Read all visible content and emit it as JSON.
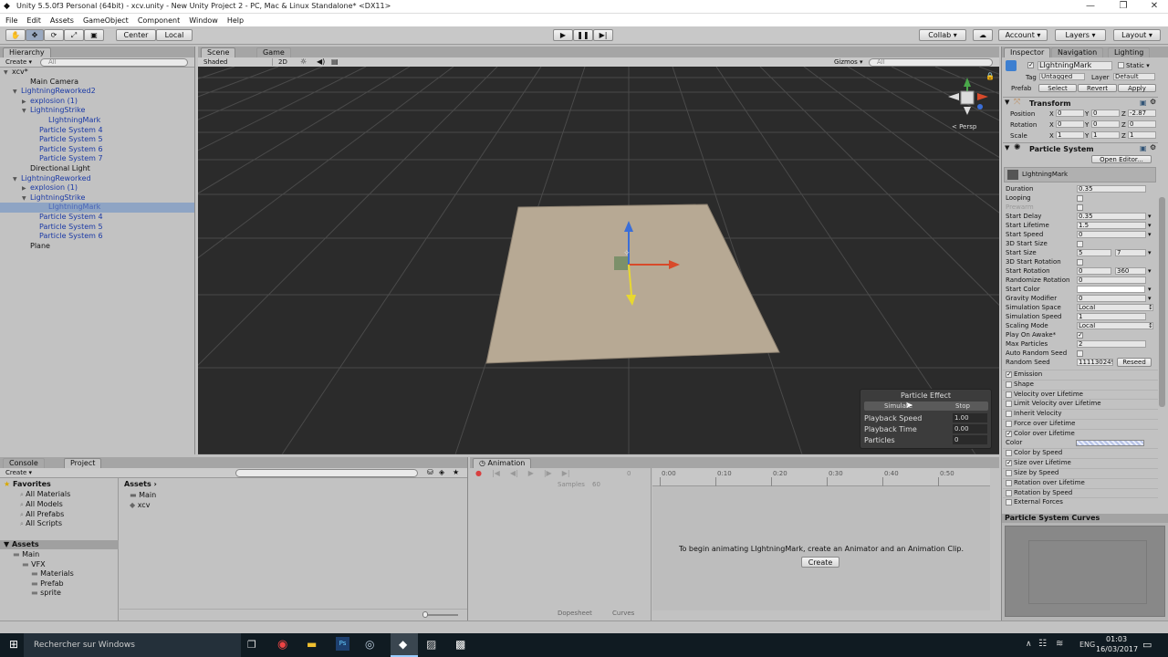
{
  "window": {
    "title": "Unity 5.5.0f3 Personal (64bit) - xcv.unity - New Unity Project 2 - PC, Mac & Linux Standalone* <DX11>",
    "controls": [
      "—",
      "❐",
      "✕"
    ]
  },
  "menu": [
    "File",
    "Edit",
    "Assets",
    "GameObject",
    "Component",
    "Window",
    "Help"
  ],
  "toolbar": {
    "center": "Center",
    "local": "Local",
    "collab": "Collab ▾",
    "account": "Account ▾",
    "layers": "Layers ▾",
    "layout": "Layout ▾",
    "icons": {
      "hand": "hand-icon",
      "move": "move-icon",
      "rotate": "rotate-icon",
      "scale": "scale-icon",
      "rect": "rect-icon",
      "play": "play-icon",
      "pause": "pause-icon",
      "step": "step-icon",
      "cloud": "cloud-icon"
    }
  },
  "hierarchy": {
    "tab": "Hierarchy",
    "create": "Create ▾",
    "search": "All",
    "items": [
      {
        "label": "xcv*",
        "indent": 0,
        "arrow": "▼",
        "blue": false,
        "sel": false
      },
      {
        "label": "Main Camera",
        "indent": 2,
        "arrow": "",
        "blue": false,
        "sel": false
      },
      {
        "label": "LightningReworked2",
        "indent": 1,
        "arrow": "▼",
        "blue": true,
        "sel": false
      },
      {
        "label": "explosion (1)",
        "indent": 2,
        "arrow": "▶",
        "blue": true,
        "sel": false
      },
      {
        "label": "LightningStrike",
        "indent": 2,
        "arrow": "▼",
        "blue": true,
        "sel": false
      },
      {
        "label": "LIghtningMark",
        "indent": 4,
        "arrow": "",
        "blue": true,
        "sel": false
      },
      {
        "label": "Particle System 4",
        "indent": 3,
        "arrow": "",
        "blue": true,
        "sel": false
      },
      {
        "label": "Particle System 5",
        "indent": 3,
        "arrow": "",
        "blue": true,
        "sel": false
      },
      {
        "label": "Particle System 6",
        "indent": 3,
        "arrow": "",
        "blue": true,
        "sel": false
      },
      {
        "label": "Particle System 7",
        "indent": 3,
        "arrow": "",
        "blue": true,
        "sel": false
      },
      {
        "label": "Directional Light",
        "indent": 2,
        "arrow": "",
        "blue": false,
        "sel": false
      },
      {
        "label": "LightningReworked",
        "indent": 1,
        "arrow": "▼",
        "blue": true,
        "sel": false
      },
      {
        "label": "explosion (1)",
        "indent": 2,
        "arrow": "▶",
        "blue": true,
        "sel": false
      },
      {
        "label": "LightningStrike",
        "indent": 2,
        "arrow": "▼",
        "blue": true,
        "sel": false
      },
      {
        "label": "LIghtningMark",
        "indent": 4,
        "arrow": "",
        "blue": true,
        "sel": true
      },
      {
        "label": "Particle System 4",
        "indent": 3,
        "arrow": "",
        "blue": true,
        "sel": false
      },
      {
        "label": "Particle System 5",
        "indent": 3,
        "arrow": "",
        "blue": true,
        "sel": false
      },
      {
        "label": "Particle System 6",
        "indent": 3,
        "arrow": "",
        "blue": true,
        "sel": false
      },
      {
        "label": "Plane",
        "indent": 2,
        "arrow": "",
        "blue": false,
        "sel": false
      }
    ]
  },
  "scene": {
    "tabs": [
      "Scene",
      "Game"
    ],
    "shaded": "Shaded",
    "mode2d": "2D",
    "fx": "☼",
    "gizmos": "Gizmos ▾",
    "search": "All",
    "persp": "< Persp",
    "particle_effect": {
      "title": "Particle Effect",
      "simulate": "Simulate",
      "stop": "Stop",
      "rows": [
        {
          "label": "Playback Speed",
          "value": "1.00"
        },
        {
          "label": "Playback Time",
          "value": "0.00"
        },
        {
          "label": "Particles",
          "value": "0"
        }
      ]
    }
  },
  "inspector": {
    "tabs": [
      "Inspector",
      "Navigation",
      "Lighting"
    ],
    "object_name": "LIghtningMark",
    "static": "Static ▾",
    "tag_label": "Tag",
    "tag": "Untagged",
    "layer_label": "Layer",
    "layer": "Default",
    "prefab_label": "Prefab",
    "prefab_buttons": [
      "Select",
      "Revert",
      "Apply"
    ],
    "transform": {
      "title": "Transform",
      "rows": [
        {
          "label": "Position",
          "x": "0",
          "y": "0",
          "z": "-2.87"
        },
        {
          "label": "Rotation",
          "x": "0",
          "y": "0",
          "z": "0"
        },
        {
          "label": "Scale",
          "x": "1",
          "y": "1",
          "z": "1"
        }
      ]
    },
    "ps_title": "Particle System",
    "open_editor": "Open Editor...",
    "ps_name": "LIghtningMark",
    "props": [
      {
        "label": "Duration",
        "type": "text",
        "value": "0.35"
      },
      {
        "label": "Looping",
        "type": "check",
        "value": ""
      },
      {
        "label": "Prewarm",
        "type": "check",
        "value": "",
        "dim": true
      },
      {
        "label": "Start Delay",
        "type": "text",
        "value": "0.35",
        "menu": true
      },
      {
        "label": "Start Lifetime",
        "type": "text",
        "value": "1.5",
        "menu": true
      },
      {
        "label": "Start Speed",
        "type": "text",
        "value": "0",
        "menu": true
      },
      {
        "label": "3D Start Size",
        "type": "check",
        "value": ""
      },
      {
        "label": "Start Size",
        "type": "range",
        "value": "5",
        "value2": "7",
        "menu": true
      },
      {
        "label": "3D Start Rotation",
        "type": "check",
        "value": ""
      },
      {
        "label": "Start Rotation",
        "type": "range",
        "value": "0",
        "value2": "360",
        "menu": true
      },
      {
        "label": "Randomize Rotation",
        "type": "text",
        "value": "0"
      },
      {
        "label": "Start Color",
        "type": "color",
        "value": "",
        "menu": true
      },
      {
        "label": "Gravity Modifier",
        "type": "text",
        "value": "0",
        "menu": true
      },
      {
        "label": "Simulation Space",
        "type": "select",
        "value": "Local"
      },
      {
        "label": "Simulation Speed",
        "type": "text",
        "value": "1"
      },
      {
        "label": "Scaling Mode",
        "type": "select",
        "value": "Local"
      },
      {
        "label": "Play On Awake*",
        "type": "check",
        "value": "✓"
      },
      {
        "label": "Max Particles",
        "type": "text",
        "value": "2"
      },
      {
        "label": "Auto Random Seed",
        "type": "check",
        "value": ""
      },
      {
        "label": "Random Seed",
        "type": "seed",
        "value": "111130249",
        "button": "Reseed"
      }
    ],
    "modules": [
      {
        "label": "Emission",
        "checked": true
      },
      {
        "label": "Shape",
        "checked": false
      },
      {
        "label": "Velocity over Lifetime",
        "checked": false
      },
      {
        "label": "Limit Velocity over Lifetime",
        "checked": false
      },
      {
        "label": "Inherit Velocity",
        "checked": false
      },
      {
        "label": "Force over Lifetime",
        "checked": false
      },
      {
        "label": "Color over Lifetime",
        "checked": true
      },
      {
        "label": "Color",
        "checked": false,
        "sub": true
      },
      {
        "label": "Color by Speed",
        "checked": false
      },
      {
        "label": "Size over Lifetime",
        "checked": true
      },
      {
        "label": "Size by Speed",
        "checked": false
      },
      {
        "label": "Rotation over Lifetime",
        "checked": false
      },
      {
        "label": "Rotation by Speed",
        "checked": false
      },
      {
        "label": "External Forces",
        "checked": false
      }
    ],
    "curves_title": "Particle System Curves"
  },
  "project": {
    "tabs": [
      "Console",
      "Project"
    ],
    "create": "Create ▾",
    "favorites_title": "Favorites",
    "favorites": [
      "All Materials",
      "All Models",
      "All Prefabs",
      "All Scripts"
    ],
    "assets_title": "Assets",
    "tree": [
      {
        "label": "Main",
        "indent": 1
      },
      {
        "label": "VFX",
        "indent": 2
      },
      {
        "label": "Materials",
        "indent": 3
      },
      {
        "label": "Prefab",
        "indent": 3
      },
      {
        "label": "sprite",
        "indent": 3
      }
    ],
    "breadcrumb": "Assets ›",
    "files": [
      "Main",
      "xcv"
    ]
  },
  "animation": {
    "tab": "Animation",
    "samples_label": "Samples",
    "samples": "60",
    "ticks": [
      "0:00",
      "0:10",
      "0:20",
      "0:30",
      "0:40",
      "0:50"
    ],
    "message": "To begin animating LIghtningMark, create an Animator and an Animation Clip.",
    "create": "Create",
    "bottom_tabs": [
      "Dopesheet",
      "Curves"
    ]
  },
  "taskbar": {
    "search": "Rechercher sur Windows",
    "lang": "ENG",
    "time": "01:03",
    "date": "16/03/2017"
  }
}
